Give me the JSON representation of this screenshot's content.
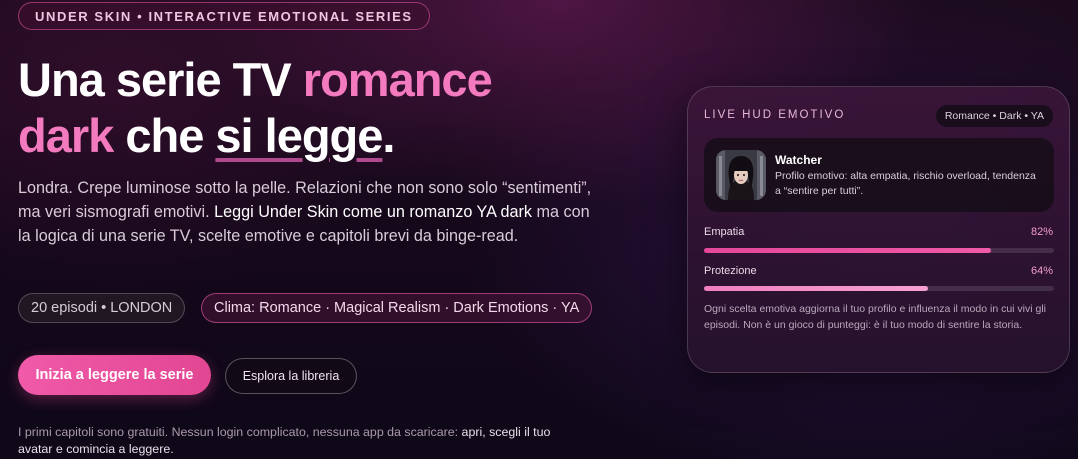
{
  "badge": "UNDER SKIN • INTERACTIVE EMOTIONAL SERIES",
  "headline": {
    "part1": "Una serie TV ",
    "part2": "romance dark",
    "part3": " che ",
    "part4": "si legge",
    "part5": "."
  },
  "intro": {
    "t1": "Londra. Crepe luminose sotto la pelle. Relazioni che non sono solo “sentimenti”, ma veri sismografi emotivi. ",
    "t2": "Leggi Under Skin come un romanzo YA dark",
    "t3": " ma con la logica di una serie TV, scelte emotive e capitoli brevi da binge-read."
  },
  "chips": {
    "episodes": "20 episodi • LONDON",
    "clima": "Clima: Romance · Magical Realism · Dark Emotions · YA"
  },
  "buttons": {
    "start": "Inizia a leggere la serie",
    "library": "Esplora la libreria"
  },
  "note": {
    "t1": "I primi capitoli sono gratuiti. Nessun login complicato, nessuna app da scaricare: ",
    "t2": "apri, scegli il tuo avatar e comincia a leggere."
  },
  "hud": {
    "title": "LIVE HUD EMOTIVO",
    "tag": "Romance • Dark • YA",
    "profile": {
      "name": "Watcher",
      "description": "Profilo emotivo: alta empatia, rischio overload, tendenza a “sentire per tutti”."
    },
    "stats": [
      {
        "label": "Empatia",
        "value": "82%",
        "fill": 0.82
      },
      {
        "label": "Protezione",
        "value": "64%",
        "fill": 0.64
      }
    ],
    "footer": "Ogni scelta emotiva aggiorna il tuo profilo e influenza il modo in cui vivi gli episodi. Non è un gioco di punteggi: è il tuo modo di sentire la storia."
  },
  "colors": {
    "accent": "#f05aa8",
    "headline_pink": "#f47ac0"
  }
}
